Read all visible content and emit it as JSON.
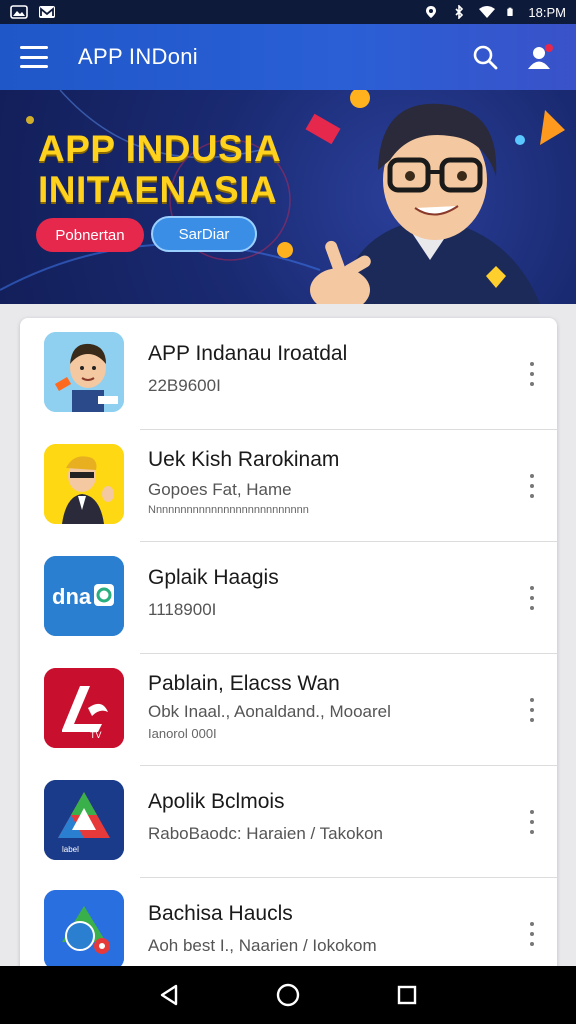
{
  "status_bar": {
    "time": "18:PM",
    "left_icons": [
      "gallery-icon",
      "mail-icon"
    ],
    "right_icons": [
      "location-icon",
      "bluetooth-icon",
      "wifi-icon",
      "battery-icon"
    ]
  },
  "app_bar": {
    "title": "APP INDoni",
    "menu_icon": "menu-icon",
    "search_icon": "search-icon",
    "account_icon": "account-icon",
    "accent": "#2a5fd6"
  },
  "banner": {
    "title_line1": "APP INDUSIA",
    "title_line2": "INITAENASIA",
    "button1_label": "Pobnertan",
    "button2_label": "SarDiar",
    "title_color": "#ffd21e",
    "button1_color": "#e6284c",
    "button2_color": "#3a8ee6"
  },
  "apps": [
    {
      "name": "APP Indanau Iroatdal",
      "subtitle": "22B9600I",
      "subtitle2": "",
      "icon": "cartoon-boy-icon"
    },
    {
      "name": "Uek Kish Rarokinam",
      "subtitle": "Gopoes Fat, Hame",
      "subtitle2": "Nnnnnnnnnnnnnnnnnnnnnnnnnn",
      "icon": "cartoon-man-icon"
    },
    {
      "name": "Gplaik Haagis",
      "subtitle": "1118900I",
      "subtitle2": "",
      "icon": "dna-icon"
    },
    {
      "name": "Pablain, Elacss Wan",
      "subtitle": "Obk Inaal., Aonaldand., Mooarel",
      "subtitle2": "Ianorol 000I",
      "icon": "red-logo-icon"
    },
    {
      "name": "Apolik Bclmois",
      "subtitle": "RaboBaodc: Haraien / Takokon",
      "subtitle2": "",
      "icon": "triangle-logo-icon"
    },
    {
      "name": "Bachisa Haucls",
      "subtitle": "Aoh best I., Naarien / Iokokom",
      "subtitle2": "",
      "icon": "blue-logo-icon"
    }
  ],
  "nav_bar": {
    "back_icon": "back-icon",
    "home_icon": "home-icon",
    "recents_icon": "recents-icon"
  }
}
